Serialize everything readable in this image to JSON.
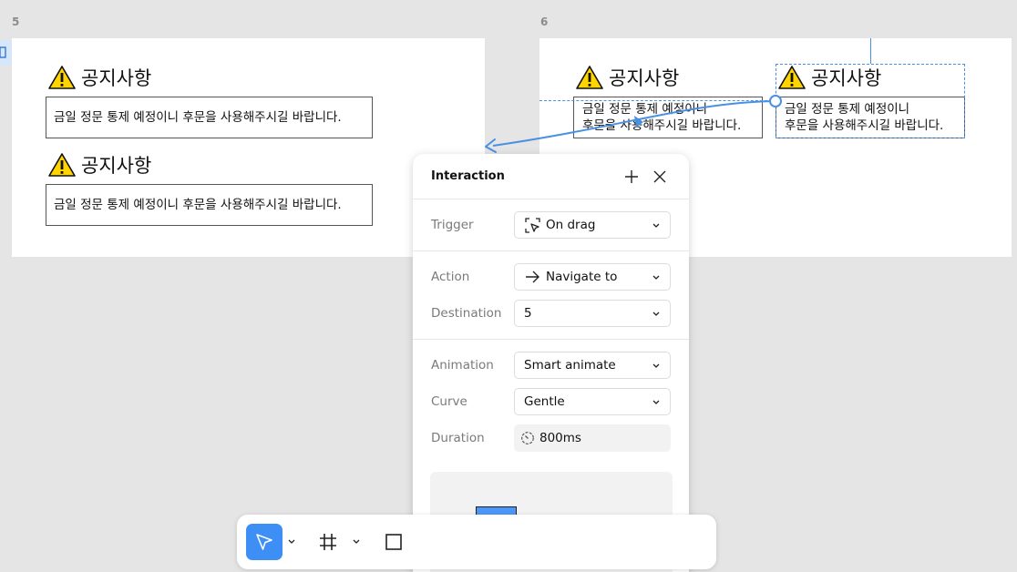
{
  "frames": {
    "left": {
      "label": "5"
    },
    "right": {
      "label": "6"
    }
  },
  "notice": {
    "title": "공지사항",
    "message": "금일 정문 통제 예정이니 후문을 사용해주시길 바랍니다.",
    "message_line1": "금일 정문 통제 예정이니",
    "message_line2": "후문을 사용해주시길 바랍니다."
  },
  "interaction_panel": {
    "title": "Interaction",
    "trigger": {
      "label": "Trigger",
      "value": "On drag",
      "icon": "drag-icon"
    },
    "action": {
      "label": "Action",
      "value": "Navigate to",
      "icon": "arrow-right-icon"
    },
    "destination": {
      "label": "Destination",
      "value": "5"
    },
    "animation": {
      "label": "Animation",
      "value": "Smart animate"
    },
    "curve": {
      "label": "Curve",
      "value": "Gentle"
    },
    "duration": {
      "label": "Duration",
      "value": "800ms",
      "icon": "timer-icon"
    }
  },
  "toolbar": {
    "tools": [
      {
        "name": "move-tool",
        "icon": "pointer-icon",
        "active": true
      },
      {
        "name": "frame-tool",
        "icon": "hash-icon",
        "active": false
      },
      {
        "name": "shape-tool",
        "icon": "rectangle-icon",
        "active": false
      }
    ]
  },
  "colors": {
    "accent": "#3d8ff5",
    "warning": "#ffd400",
    "preview_box": "#4d96fa",
    "canvas": "#e5e5e5"
  }
}
